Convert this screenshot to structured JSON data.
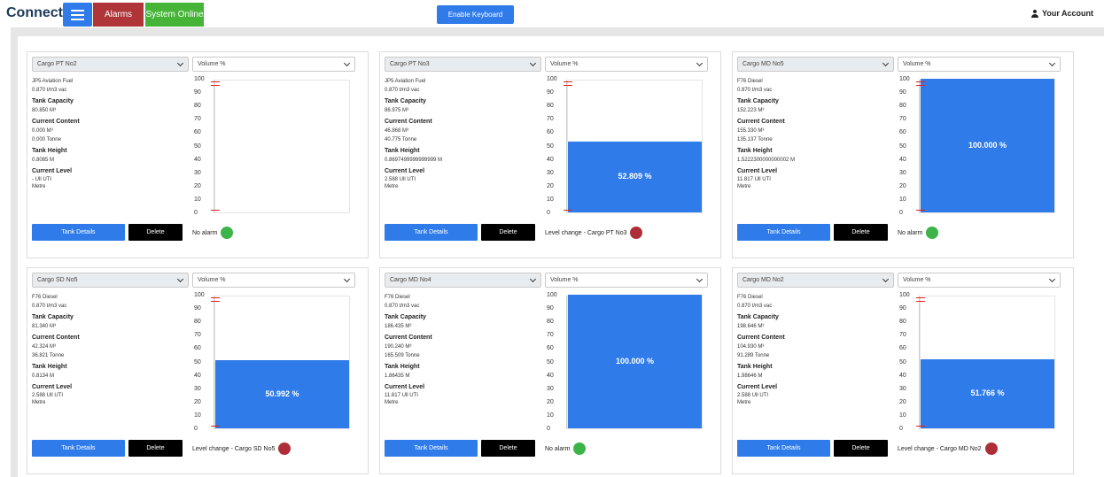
{
  "header": {
    "brand": "Connect",
    "alarms_label": "Alarms",
    "status_label": "System Online",
    "keyboard_label": "Enable Keyboard",
    "account_label": "Your Account"
  },
  "common": {
    "metric": "Volume %",
    "details_label": "Tank Details",
    "delete_label": "Delete",
    "labels": {
      "capacity": "Tank Capacity",
      "content": "Current Content",
      "height": "Tank Height",
      "level": "Current Level"
    },
    "y_ticks": [
      "100",
      "90",
      "80",
      "70",
      "60",
      "50",
      "40",
      "30",
      "20",
      "10",
      "0"
    ]
  },
  "tanks": [
    {
      "name": "Cargo PT No2",
      "fuel": "JP5 Aviation Fuel",
      "density": "0.870 t/m3 vac",
      "capacity": "80.850 M³",
      "content_volume": "0.000 M³",
      "content_mass": "0.000 Tonne",
      "height": "0.8085 M",
      "level": "- Ull UTI",
      "level_unit": "Metre",
      "percent": 0,
      "percent_label": "",
      "markers": [
        97,
        3
      ],
      "status": "No alarm",
      "status_color": "green"
    },
    {
      "name": "Cargo PT No3",
      "fuel": "JP5 Aviation Fuel",
      "density": "0.870 t/m3 vac",
      "capacity": "86.975 M³",
      "content_volume": "46.868 M³",
      "content_mass": "40.775 Tonne",
      "height": "0.8697499999999999 M",
      "level": "2.588 Ull UTI",
      "level_unit": "Metre",
      "percent": 52.809,
      "percent_label": "52.809 %",
      "markers": [
        97,
        3
      ],
      "status": "Level change - Cargo PT No3",
      "status_color": "red"
    },
    {
      "name": "Cargo MD No5",
      "fuel": "F76 Diesel",
      "density": "0.870 t/m3 vac",
      "capacity": "152.223 M³",
      "content_volume": "155.330 M³",
      "content_mass": "135.137 Tonne",
      "height": "1.5222300000000002 M",
      "level": "11.817 Ull UTI",
      "level_unit": "Metre",
      "percent": 100,
      "percent_label": "100.000 %",
      "markers": [
        97,
        3
      ],
      "status": "No alarm",
      "status_color": "green"
    },
    {
      "name": "Cargo SD No5",
      "fuel": "F76 Diesel",
      "density": "0.870 t/m3 vac",
      "capacity": "81.340 M³",
      "content_volume": "42.324 M³",
      "content_mass": "36.821 Tonne",
      "height": "0.8134 M",
      "level": "2.588 Ull UTI",
      "level_unit": "Metre",
      "percent": 50.992,
      "percent_label": "50.992 %",
      "markers": [
        97,
        3
      ],
      "status": "Level change - Cargo SD No5",
      "status_color": "red"
    },
    {
      "name": "Cargo MD No4",
      "fuel": "F76 Diesel",
      "density": "0.870 t/m3 vac",
      "capacity": "186.435 M³",
      "content_volume": "190.240 M³",
      "content_mass": "165.509 Tonne",
      "height": "1.86435 M",
      "level": "11.817 Ull UTI",
      "level_unit": "Metre",
      "percent": 100,
      "percent_label": "100.000 %",
      "markers": [],
      "status": "No alarm",
      "status_color": "green"
    },
    {
      "name": "Cargo MD No2",
      "fuel": "F76 Diesel",
      "density": "0.870 t/m3 vac",
      "capacity": "198.646 M³",
      "content_volume": "104.930 M³",
      "content_mass": "91.289 Tonne",
      "height": "1.98646 M",
      "level": "2.588 Ull UTI",
      "level_unit": "Metre",
      "percent": 51.766,
      "percent_label": "51.766 %",
      "markers": [
        97,
        3
      ],
      "status": "Level change - Cargo MD No2",
      "status_color": "red"
    }
  ]
}
